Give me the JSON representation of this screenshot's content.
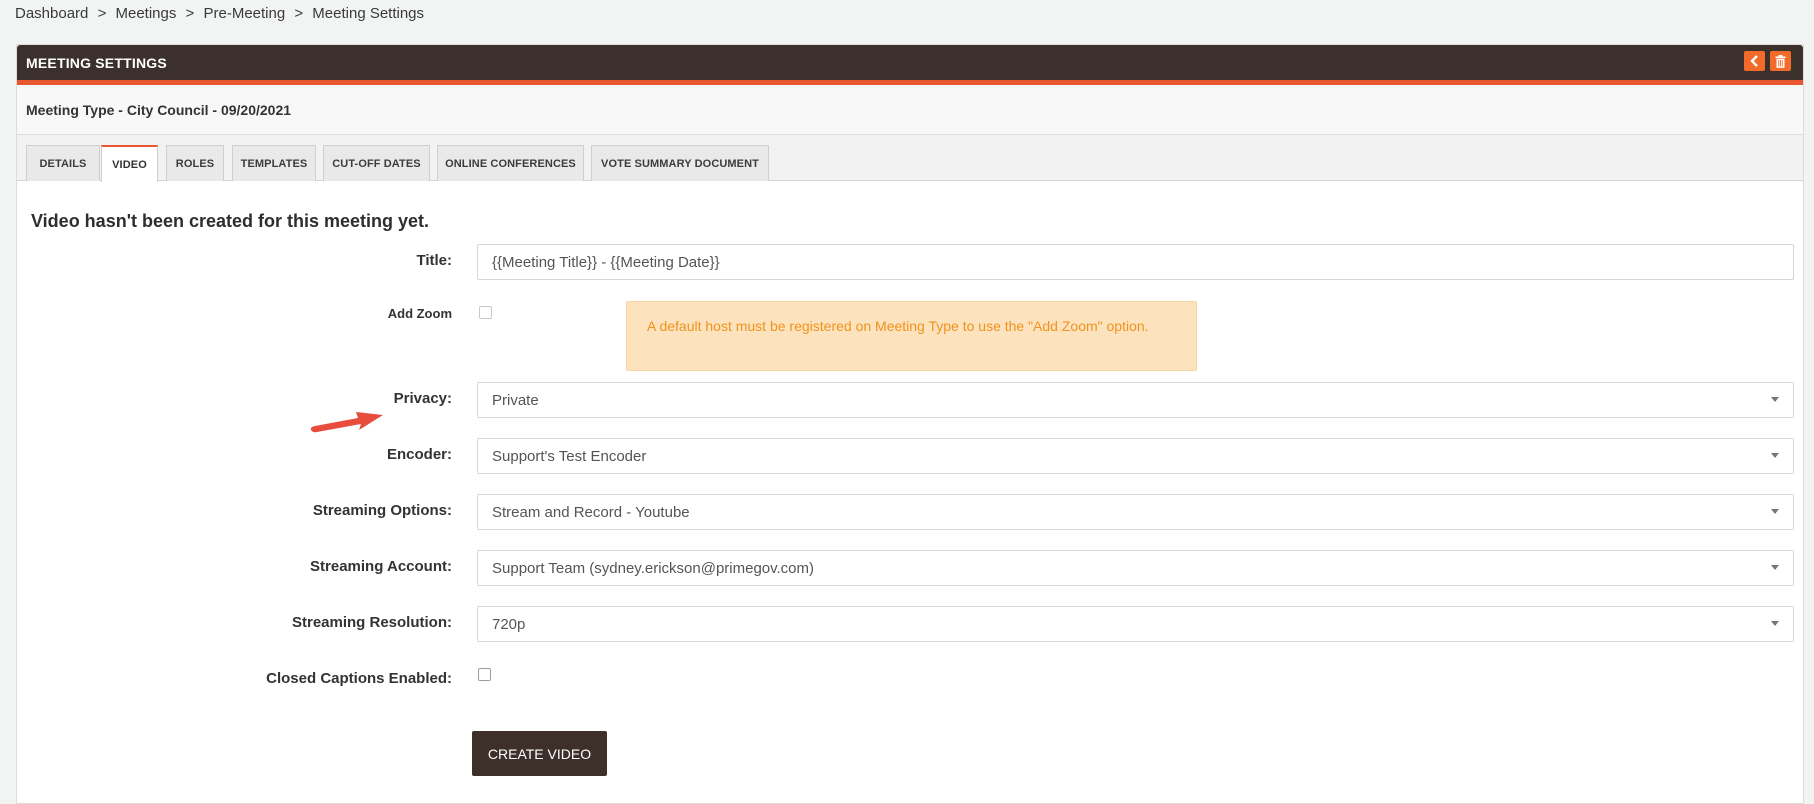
{
  "breadcrumb": [
    "Dashboard",
    "Meetings",
    "Pre-Meeting",
    "Meeting Settings"
  ],
  "breadcrumb_sep": ">",
  "panel": {
    "title": "MEETING SETTINGS",
    "subtitle": "Meeting Type - City Council - 09/20/2021"
  },
  "tabs": [
    {
      "label": "DETAILS",
      "active": false
    },
    {
      "label": "VIDEO",
      "active": true
    },
    {
      "label": "ROLES",
      "active": false
    },
    {
      "label": "TEMPLATES",
      "active": false
    },
    {
      "label": "CUT-OFF DATES",
      "active": false
    },
    {
      "label": "ONLINE CONFERENCES",
      "active": false
    },
    {
      "label": "VOTE SUMMARY DOCUMENT",
      "active": false
    }
  ],
  "video": {
    "notice": "Video hasn't been created for this meeting yet.",
    "title_label": "Title:",
    "title_value": "{{Meeting Title}} - {{Meeting Date}}",
    "add_zoom_label": "Add Zoom",
    "add_zoom_checked": false,
    "zoom_alert": "A default host must be registered on Meeting Type to use the \"Add Zoom\" option.",
    "privacy_label": "Privacy:",
    "privacy_value": "Private",
    "encoder_label": "Encoder:",
    "encoder_value": "Support's Test Encoder",
    "streaming_options_label": "Streaming Options:",
    "streaming_options_value": "Stream and Record - Youtube",
    "streaming_account_label": "Streaming Account:",
    "streaming_account_value": "Support Team (sydney.erickson@primegov.com)",
    "streaming_resolution_label": "Streaming Resolution:",
    "streaming_resolution_value": "720p",
    "closed_captions_label": "Closed Captions Enabled:",
    "closed_captions_checked": false,
    "create_button": "CREATE VIDEO"
  },
  "icons": {
    "back": "chevron-left-icon",
    "delete": "trash-icon",
    "annotation": "red-arrow-icon",
    "select_caret": "chevron-down-icon"
  },
  "colors": {
    "header_bg": "#3c302c",
    "accent": "#e8572f",
    "alert_bg": "#fde3bd",
    "alert_text": "#f0921d",
    "button_bg": "#3d302b"
  }
}
